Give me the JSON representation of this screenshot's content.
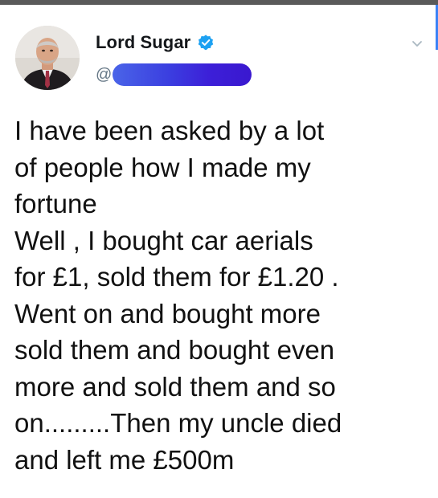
{
  "user": {
    "display_name": "Lord Sugar",
    "handle_prefix": "@",
    "verified": true
  },
  "tweet": {
    "lines": [
      "I have been asked by a lot",
      "of people how I made my",
      "fortune",
      "Well , I bought car aerials",
      "for £1, sold them for £1.20 .",
      "Went on and bought more",
      "sold them and bought even",
      "more and sold them and so",
      "on.........Then my uncle died",
      "and left  me £500m"
    ]
  },
  "colors": {
    "verified_badge": "#1da1f2",
    "handle_redaction": "#3c2fe0",
    "handle_text": "#657786"
  },
  "icons": {
    "verified": "verified-badge-icon",
    "menu": "chevron-down-icon"
  }
}
